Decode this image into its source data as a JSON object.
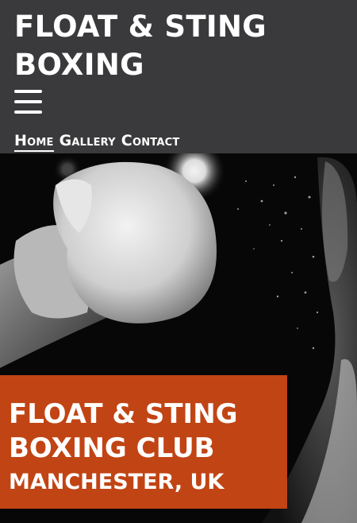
{
  "header": {
    "brand": "FLOAT & STING BOXING",
    "menu_icon": "hamburger-menu-icon"
  },
  "nav": {
    "items": [
      {
        "label": "Home",
        "active": true
      },
      {
        "label": "Gallery",
        "active": false
      },
      {
        "label": "Contact",
        "active": false
      }
    ]
  },
  "hero": {
    "image": "boxing-glove-punch-photo",
    "title": "FLOAT & STING BOXING CLUB",
    "subtitle": "MANCHESTER, UK"
  },
  "colors": {
    "header_bg": "#3a3a3c",
    "banner_bg": "#c14414",
    "text": "#ffffff"
  }
}
